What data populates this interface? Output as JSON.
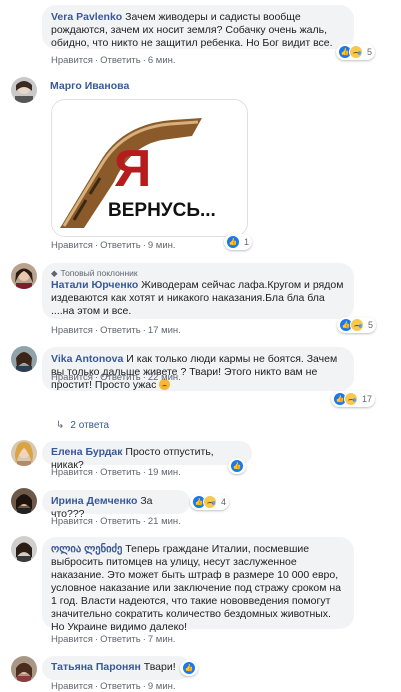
{
  "colors": {
    "author": "#385898",
    "bubble": "#f2f3f5",
    "meta": "#606770",
    "like": "#1877f2"
  },
  "comments": [
    {
      "author": "Vera Pavlenko",
      "text": "Зачем живодеры и садисты вообще рождаются, зачем их носит земля? Собачку очень жаль, обидно, что никто не защитил ребенка. Но Бог видит все.",
      "like": "Нравится",
      "reply": "Ответить",
      "time": "6 мин.",
      "reactions": "5"
    },
    {
      "author": "Марго Иванова",
      "image_text": "Я ВЕРНУСЬ...",
      "like": "Нравится",
      "reply": "Ответить",
      "time": "9 мин.",
      "reactions": "1"
    },
    {
      "badge": "Топовый поклонник",
      "author": "Натали Юрченко",
      "text": "Живодерам сейчас лафа.Кругом и рядом издеваются как хотят и никакого наказания.Бла бла бла ....на этом и все.",
      "like": "Нравится",
      "reply": "Ответить",
      "time": "17 мин.",
      "reactions": "5"
    },
    {
      "author": "Vika Antonova",
      "text": "И как только люди кармы не боятся. Зачем вы только дальше живете ? Твари! Этого никто вам не простит! Просто ужас",
      "like": "Нравится",
      "reply": "Ответить",
      "time": "22 мин.",
      "reactions": "17",
      "replies": "2 ответа"
    },
    {
      "author": "Елена Бурдак",
      "text": "Просто отпустить, никак?",
      "like": "Нравится",
      "reply": "Ответить",
      "time": "19 мин."
    },
    {
      "author": "Ирина Демченко",
      "text": "За что???",
      "like": "Нравится",
      "reply": "Ответить",
      "time": "21 мин.",
      "reactions": "4"
    },
    {
      "author": "ოლია ლენიძე",
      "text": "Теперь граждане Италии, посмевшие выбросить питомцев на улицу, несут заслуженное наказание. Это может быть штраф в размере 10 000 евро, условное наказание или заключение под стражу сроком на 1 год. Власти надеются, что такие нововведения помогут значительно сократить количество бездомных животных.",
      "text2": "Но Украине видимо далеко!",
      "like": "Нравится",
      "reply": "Ответить",
      "time": "7 мин."
    },
    {
      "author": "Татьяна Паронян",
      "text": "Твари!",
      "like": "Нравится",
      "reply": "Ответить",
      "time": "9 мин."
    }
  ]
}
